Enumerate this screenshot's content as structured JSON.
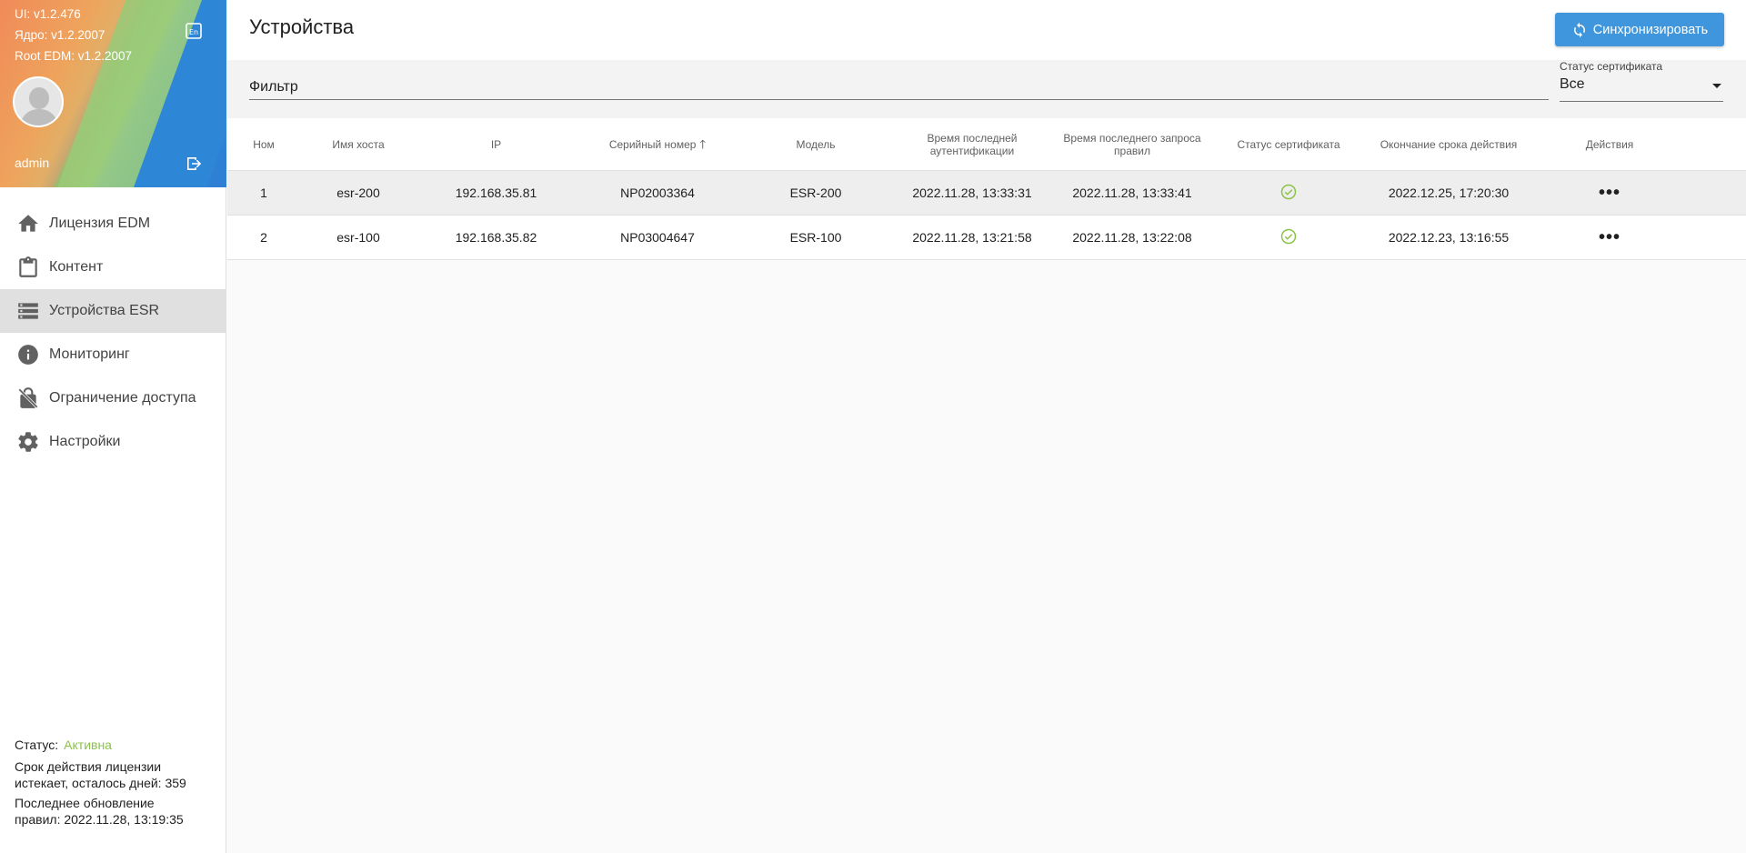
{
  "sidebar": {
    "versions": {
      "ui": "UI: v1.2.476",
      "core": "Ядро: v1.2.2007",
      "root_edm": "Root EDM: v1.2.2007"
    },
    "username": "admin",
    "menu": [
      {
        "label": "Лицензия EDM",
        "icon": "home-icon"
      },
      {
        "label": "Контент",
        "icon": "clipboard-icon"
      },
      {
        "label": "Устройства ESR",
        "icon": "device-list-icon",
        "active": true
      },
      {
        "label": "Мониторинг",
        "icon": "info-icon"
      },
      {
        "label": "Ограничение доступа",
        "icon": "lock-icon"
      },
      {
        "label": "Настройки",
        "icon": "gear-icon"
      }
    ],
    "footer": {
      "status_label": "Статус:",
      "status_value": "Активна",
      "license_line1": "Срок действия лицензии",
      "license_line2": "истекает, осталось дней: 359",
      "update_line1": "Последнее обновление",
      "update_line2": "правил: 2022.11.28, 13:19:35"
    }
  },
  "header": {
    "title": "Устройства",
    "sync_label": "Синхронизировать"
  },
  "filter": {
    "placeholder": "Фильтр",
    "cert_status_label": "Статус сертификата",
    "cert_status_value": "Все"
  },
  "table": {
    "columns": {
      "num": "Ном",
      "host": "Имя хоста",
      "ip": "IP",
      "serial": "Серийный номер",
      "model": "Модель",
      "last_auth_1": "Время последней",
      "last_auth_2": "аутентификации",
      "last_rules_1": "Время последнего запроса",
      "last_rules_2": "правил",
      "cert_status": "Статус сертификата",
      "expiry": "Окончание срока действия",
      "actions": "Действия"
    },
    "rows": [
      {
        "num": "1",
        "host": "esr-200",
        "ip": "192.168.35.81",
        "serial": "NP02003364",
        "model": "ESR-200",
        "last_auth": "2022.11.28, 13:33:31",
        "last_rules": "2022.11.28, 13:33:41",
        "cert_ok": true,
        "expiry": "2022.12.25, 17:20:30",
        "actions": "•••"
      },
      {
        "num": "2",
        "host": "esr-100",
        "ip": "192.168.35.82",
        "serial": "NP03004647",
        "model": "ESR-100",
        "last_auth": "2022.11.28, 13:21:58",
        "last_rules": "2022.11.28, 13:22:08",
        "cert_ok": true,
        "expiry": "2022.12.23, 13:16:55",
        "actions": "•••"
      }
    ]
  },
  "colors": {
    "accent": "#3f96dd",
    "status_active": "#8bc34a",
    "cert_ok": "#8bc34a"
  }
}
